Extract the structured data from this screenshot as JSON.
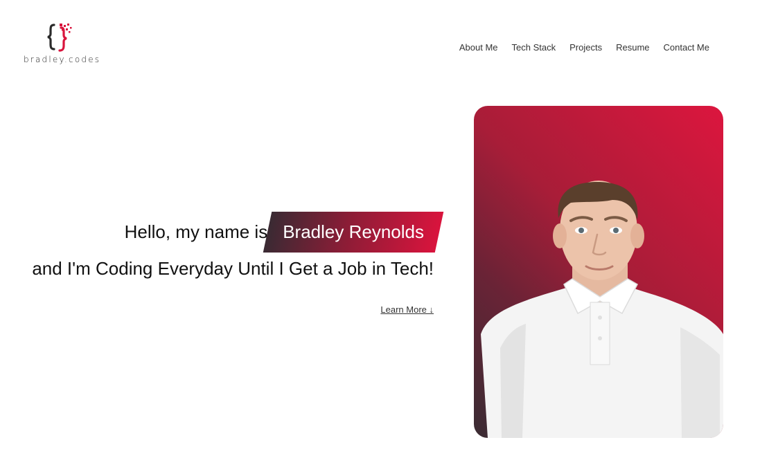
{
  "logo": {
    "text": "bradley.codes",
    "icon": "curly-braces-logo-icon",
    "colors": {
      "dark": "#2b2b2b",
      "accent": "#d9143d"
    }
  },
  "nav": {
    "items": [
      {
        "label": "About Me"
      },
      {
        "label": "Tech Stack"
      },
      {
        "label": "Projects"
      },
      {
        "label": "Resume"
      },
      {
        "label": "Contact Me"
      }
    ]
  },
  "hero": {
    "greeting": "Hello, my name is",
    "name": "Bradley Reynolds",
    "tagline": "and I'm Coding Everyday Until I Get a Job in Tech!",
    "learn_more": "Learn More ↓"
  },
  "portrait": {
    "gradient_colors": [
      "#dc163e",
      "#3a2c33"
    ]
  }
}
